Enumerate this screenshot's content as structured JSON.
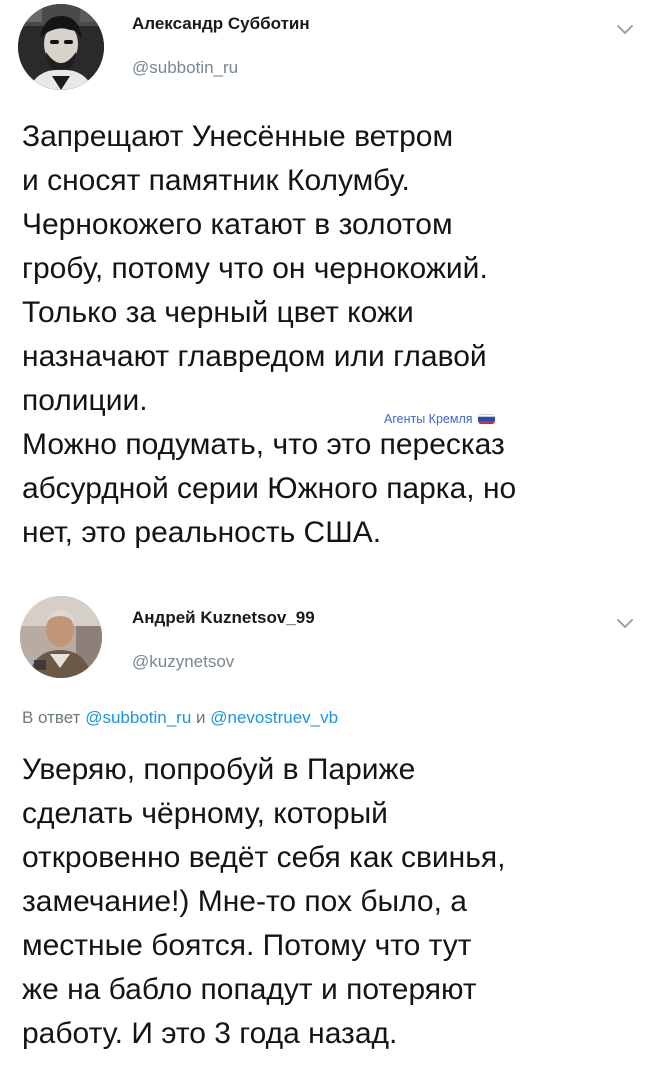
{
  "tweets": [
    {
      "author": "Александр Субботин",
      "handle": "@subbotin_ru",
      "text_lines": [
        "Запрещают Унесённые ветром",
        "и сносят памятник Колумбу.",
        "Чернокожего катают в золотом",
        "гробу, потому что он чернокожий.",
        "Только за черный цвет кожи",
        "назначают главредом или главой",
        "полиции.",
        "Можно подумать, что это пересказ",
        "абсурдной серии Южного парка, но",
        "нет, это реальность США."
      ]
    },
    {
      "author": "Андрей Kuznetsov_99",
      "handle": "@kuzynetsov",
      "reply_prefix": "В ответ",
      "reply_mention_1": "@subbotin_ru",
      "reply_conjunction": "и",
      "reply_mention_2": "@nevostruev_vb",
      "text_lines": [
        "Уверяю, попробуй в Париже",
        "сделать чёрному, который",
        "откровенно ведёт себя как свинья,",
        "замечание!) Мне-то пох было, а",
        "местные боятся. Потому что тут",
        "же на бабло попадут и потеряют",
        "работу. И это 3 года назад."
      ]
    }
  ],
  "watermark": {
    "text": "Агенты Кремля",
    "icon": "russian-flag-icon",
    "color": "#3d66d6"
  },
  "colors": {
    "handle": "#7a8690",
    "mention": "#1b95e0",
    "text": "#141414"
  },
  "icons": {
    "menu": "chevron-down-icon"
  }
}
